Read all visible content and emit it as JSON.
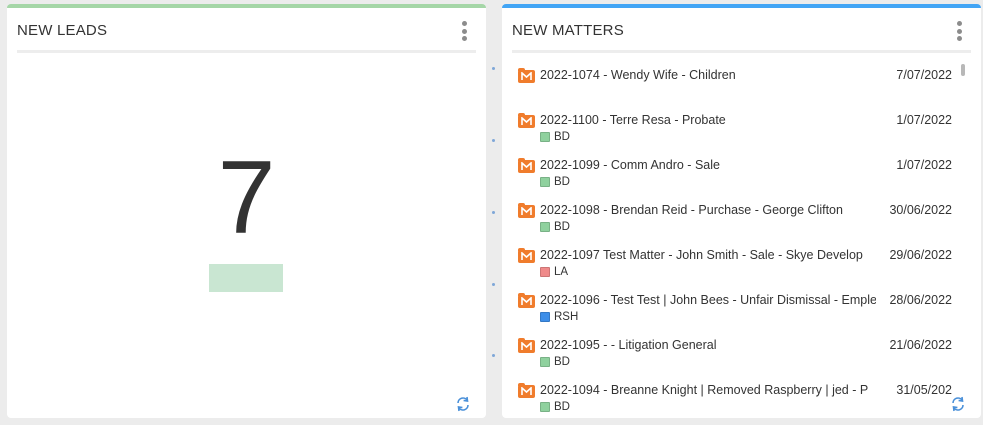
{
  "leads_widget": {
    "title": "NEW LEADS",
    "count": "7"
  },
  "matters_widget": {
    "title": "NEW MATTERS",
    "items": [
      {
        "title": "2022-1074 - Wendy Wife - Children",
        "date": "7/07/2022",
        "tag": "",
        "tag_color": ""
      },
      {
        "title": "2022-1100 - Terre Resa - Probate",
        "date": "1/07/2022",
        "tag": "BD",
        "tag_color": "#8fd19e"
      },
      {
        "title": "2022-1099 - Comm Andro - Sale",
        "date": "1/07/2022",
        "tag": "BD",
        "tag_color": "#8fd19e"
      },
      {
        "title": "2022-1098 - Brendan Reid - Purchase - George Clifton",
        "date": "30/06/2022",
        "tag": "BD",
        "tag_color": "#8fd19e"
      },
      {
        "title": "2022-1097 Test Matter  - John Smith - Sale - Skye Develop",
        "date": "29/06/2022",
        "tag": "LA",
        "tag_color": "#ef8a8a"
      },
      {
        "title": "2022-1096 - Test Test | John Bees - Unfair Dismissal - Emple",
        "date": "28/06/2022",
        "tag": "RSH",
        "tag_color": "#3d8ee8"
      },
      {
        "title": "2022-1095 -  - Litigation General",
        "date": "21/06/2022",
        "tag": "BD",
        "tag_color": "#8fd19e"
      },
      {
        "title": "2022-1094 - Breanne Knight | Removed Raspberry | jed - P",
        "date": "31/05/202",
        "tag": "BD",
        "tag_color": "#8fd19e"
      }
    ]
  },
  "colors": {
    "leads_accent": "#a5d6a7",
    "matters_accent": "#42a5f5",
    "matter_icon": "#f07c2c",
    "refresh_icon": "#4a90d9"
  }
}
